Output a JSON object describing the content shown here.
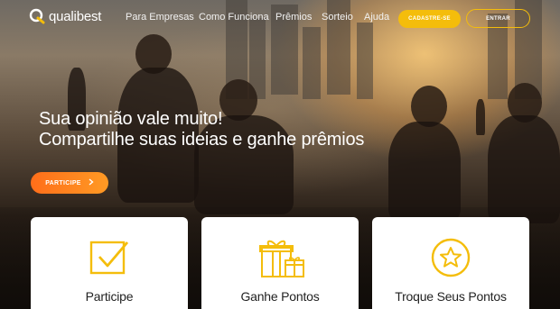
{
  "brand": {
    "name": "qualibest",
    "accent": "#f4bd0b",
    "cta_gradient": [
      "#ff6e1a",
      "#ff9a24"
    ]
  },
  "nav": {
    "links": [
      "Para Empresas",
      "Como Funciona",
      "Prêmios",
      "Sorteio",
      "Ajuda"
    ],
    "signup_label": "CADASTRE-SE",
    "login_label": "ENTRAR"
  },
  "hero": {
    "headline_line1": "Sua opinião vale muito!",
    "headline_line2": "Compartilhe suas ideias e ganhe prêmios",
    "cta_label": "PARTICIPE",
    "cta_icon": "chevron-right-icon"
  },
  "cards": [
    {
      "title": "Participe",
      "icon": "checkbox-icon"
    },
    {
      "title": "Ganhe Pontos",
      "icon": "gifts-icon"
    },
    {
      "title": "Troque Seus Pontos",
      "icon": "star-badge-icon"
    }
  ]
}
